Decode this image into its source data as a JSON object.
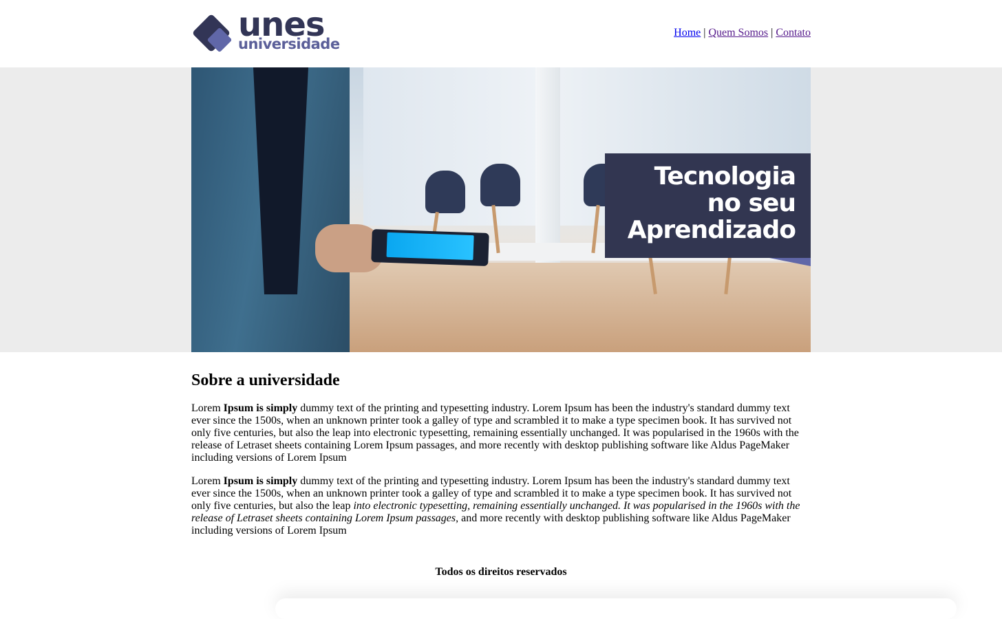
{
  "brand": {
    "name": "unes",
    "subtitle": "universidade",
    "primary_color": "#323556",
    "accent_color": "#5b5f99"
  },
  "nav": {
    "items": [
      {
        "label": "Home"
      },
      {
        "label": "Quem Somos"
      },
      {
        "label": "Contato"
      }
    ],
    "separator": "|"
  },
  "hero": {
    "promo_lines": [
      "Tecnologia",
      "no seu",
      "Aprendizado"
    ],
    "promo_bg": "#323651"
  },
  "about": {
    "heading": "Sobre a universidade",
    "paragraph1": {
      "lead": "Lorem ",
      "bold": "Ipsum is simply",
      "rest": " dummy text of the printing and typesetting industry. Lorem Ipsum has been the industry's standard dummy text ever since the 1500s, when an unknown printer took a galley of type and scrambled it to make a type specimen book. It has survived not only five centuries, but also the leap into electronic typesetting, remaining essentially unchanged. It was popularised in the 1960s with the release of Letraset sheets containing Lorem Ipsum passages, and more recently with desktop publishing software like Aldus PageMaker including versions of Lorem Ipsum"
    },
    "paragraph2": {
      "lead": "Lorem ",
      "bold": "Ipsum is simply",
      "middle": " dummy text of the printing and typesetting industry. Lorem Ipsum has been the industry's standard dummy text ever since the 1500s, when an unknown printer took a galley of type and scrambled it to make a type specimen book. It has survived not only five centuries, but also the leap ",
      "italic": "into electronic typesetting, remaining essentially unchanged. It was popularised in the 1960s with the release of Letraset sheets containing Lorem Ipsum passages",
      "rest": ", and more recently with desktop publishing software like Aldus PageMaker including versions of Lorem Ipsum"
    }
  },
  "footer": {
    "text": "Todos os direitos reservados"
  }
}
